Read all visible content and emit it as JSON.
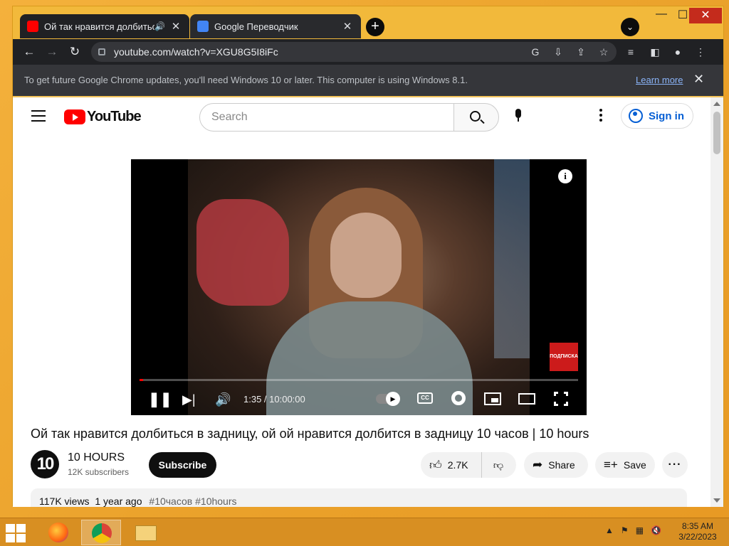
{
  "browser": {
    "tabs": [
      {
        "title": "Ой так нравится долбиться",
        "active": true
      },
      {
        "title": "Google Переводчик",
        "active": false
      }
    ],
    "url": "youtube.com/watch?v=XGU8G5I8iFc",
    "infobar": {
      "message": "To get future Google Chrome updates, you'll need Windows 10 or later. This computer is using Windows 8.1.",
      "link": "Learn more"
    }
  },
  "youtube": {
    "logo_text": "YouTube",
    "search_placeholder": "Search",
    "signin_label": "Sign in",
    "player": {
      "time": "1:35 / 10:00:00",
      "progress": 0.0026,
      "badge_text": "ПОДПИСКА",
      "info_icon": "i",
      "cc_label": "CC"
    },
    "video": {
      "title": "Ой так нравится долбиться в задницу, ой ой нравится долбится в задницу 10 часов | 10 hours",
      "channel_avatar_text": "10",
      "channel_name": "10 HOURS",
      "subscribers": "12K subscribers",
      "subscribe_label": "Subscribe",
      "likes": "2.7K",
      "share_label": "Share",
      "save_label": "Save",
      "views": "117K views",
      "age": "1 year ago",
      "tags": "#10часов #10hours"
    }
  },
  "taskbar": {
    "time": "8:35 AM",
    "date": "3/22/2023"
  },
  "colors": {
    "youtube_red": "#ff0000",
    "link_blue": "#065fd4",
    "chrome_dark": "#202124",
    "desktop_orange": "#f0a830"
  }
}
